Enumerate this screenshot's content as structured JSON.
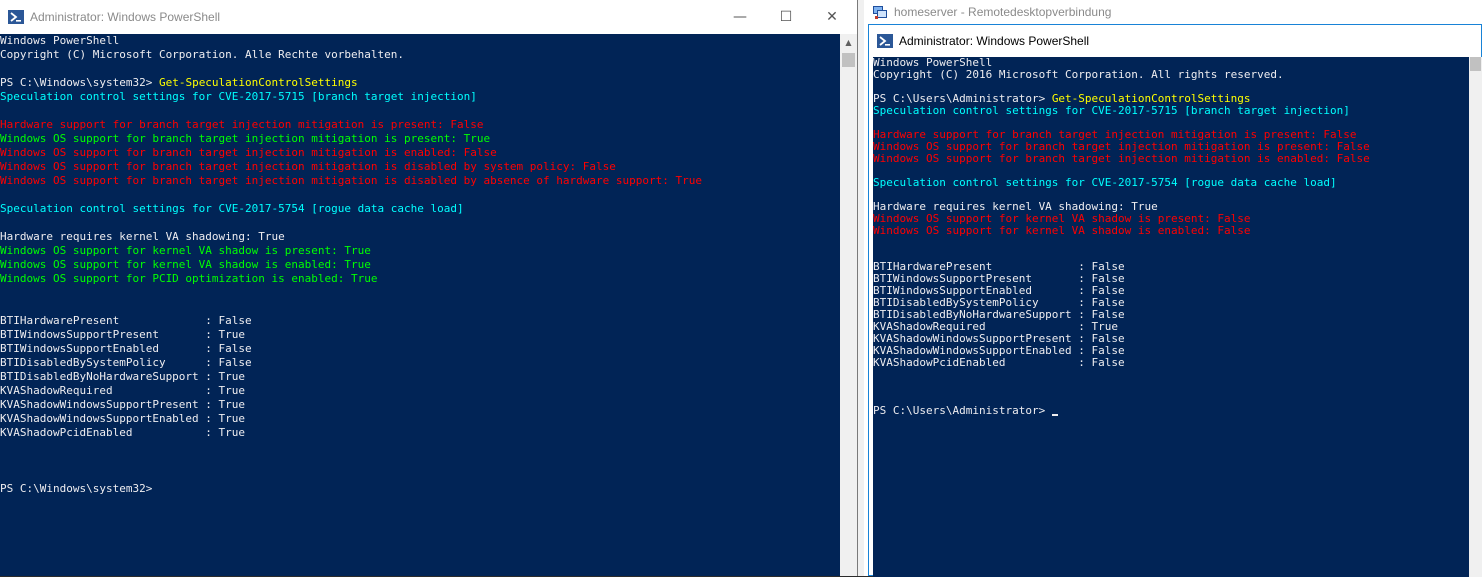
{
  "left_window": {
    "title": "Administrator: Windows PowerShell",
    "controls": {
      "minimize": "—",
      "maximize": "☐",
      "close": "✕"
    },
    "console": {
      "lines": [
        {
          "text": "Windows PowerShell",
          "color": "default"
        },
        {
          "text": "Copyright (C) Microsoft Corporation. Alle Rechte vorbehalten.",
          "color": "default"
        },
        {
          "text": "",
          "color": "default"
        },
        {
          "prompt": "PS C:\\Windows\\system32> ",
          "cmd": "Get-SpeculationControlSettings"
        },
        {
          "text": "Speculation control settings for CVE-2017-5715 [branch target injection]",
          "color": "cyan"
        },
        {
          "text": "",
          "color": "default"
        },
        {
          "text": "Hardware support for branch target injection mitigation is present: False",
          "color": "red"
        },
        {
          "text": "Windows OS support for branch target injection mitigation is present: True",
          "color": "green"
        },
        {
          "text": "Windows OS support for branch target injection mitigation is enabled: False",
          "color": "red"
        },
        {
          "text": "Windows OS support for branch target injection mitigation is disabled by system policy: False",
          "color": "red"
        },
        {
          "text": "Windows OS support for branch target injection mitigation is disabled by absence of hardware support: True",
          "color": "red"
        },
        {
          "text": "",
          "color": "default"
        },
        {
          "text": "Speculation control settings for CVE-2017-5754 [rogue data cache load]",
          "color": "cyan"
        },
        {
          "text": "",
          "color": "default"
        },
        {
          "text": "Hardware requires kernel VA shadowing: True",
          "color": "default"
        },
        {
          "text": "Windows OS support for kernel VA shadow is present: True",
          "color": "green"
        },
        {
          "text": "Windows OS support for kernel VA shadow is enabled: True",
          "color": "green"
        },
        {
          "text": "Windows OS support for PCID optimization is enabled: True",
          "color": "green"
        },
        {
          "text": "",
          "color": "default"
        },
        {
          "text": "",
          "color": "default"
        },
        {
          "text": "BTIHardwarePresent             : False",
          "color": "default"
        },
        {
          "text": "BTIWindowsSupportPresent       : True",
          "color": "default"
        },
        {
          "text": "BTIWindowsSupportEnabled       : False",
          "color": "default"
        },
        {
          "text": "BTIDisabledBySystemPolicy      : False",
          "color": "default"
        },
        {
          "text": "BTIDisabledByNoHardwareSupport : True",
          "color": "default"
        },
        {
          "text": "KVAShadowRequired              : True",
          "color": "default"
        },
        {
          "text": "KVAShadowWindowsSupportPresent : True",
          "color": "default"
        },
        {
          "text": "KVAShadowWindowsSupportEnabled : True",
          "color": "default"
        },
        {
          "text": "KVAShadowPcidEnabled           : True",
          "color": "default"
        },
        {
          "text": "",
          "color": "default"
        },
        {
          "text": "",
          "color": "default"
        },
        {
          "text": "",
          "color": "default"
        },
        {
          "text": "PS C:\\Windows\\system32>",
          "color": "default"
        }
      ]
    }
  },
  "right_window": {
    "rdp_title": "homeserver - Remotedesktopverbindung",
    "inner_title": "Administrator: Windows PowerShell",
    "console": {
      "lines": [
        {
          "text": "Windows PowerShell",
          "color": "default"
        },
        {
          "text": "Copyright (C) 2016 Microsoft Corporation. All rights reserved.",
          "color": "default"
        },
        {
          "text": "",
          "color": "default"
        },
        {
          "prompt": "PS C:\\Users\\Administrator> ",
          "cmd": "Get-SpeculationControlSettings"
        },
        {
          "text": "Speculation control settings for CVE-2017-5715 [branch target injection]",
          "color": "cyan"
        },
        {
          "text": "",
          "color": "default"
        },
        {
          "text": "Hardware support for branch target injection mitigation is present: False",
          "color": "red"
        },
        {
          "text": "Windows OS support for branch target injection mitigation is present: False",
          "color": "red"
        },
        {
          "text": "Windows OS support for branch target injection mitigation is enabled: False",
          "color": "red"
        },
        {
          "text": "",
          "color": "default"
        },
        {
          "text": "Speculation control settings for CVE-2017-5754 [rogue data cache load]",
          "color": "cyan"
        },
        {
          "text": "",
          "color": "default"
        },
        {
          "text": "Hardware requires kernel VA shadowing: True",
          "color": "default"
        },
        {
          "text": "Windows OS support for kernel VA shadow is present: False",
          "color": "red"
        },
        {
          "text": "Windows OS support for kernel VA shadow is enabled: False",
          "color": "red"
        },
        {
          "text": "",
          "color": "default"
        },
        {
          "text": "",
          "color": "default"
        },
        {
          "text": "BTIHardwarePresent             : False",
          "color": "default"
        },
        {
          "text": "BTIWindowsSupportPresent       : False",
          "color": "default"
        },
        {
          "text": "BTIWindowsSupportEnabled       : False",
          "color": "default"
        },
        {
          "text": "BTIDisabledBySystemPolicy      : False",
          "color": "default"
        },
        {
          "text": "BTIDisabledByNoHardwareSupport : False",
          "color": "default"
        },
        {
          "text": "KVAShadowRequired              : True",
          "color": "default"
        },
        {
          "text": "KVAShadowWindowsSupportPresent : False",
          "color": "default"
        },
        {
          "text": "KVAShadowWindowsSupportEnabled : False",
          "color": "default"
        },
        {
          "text": "KVAShadowPcidEnabled           : False",
          "color": "default"
        },
        {
          "text": "",
          "color": "default"
        },
        {
          "text": "",
          "color": "default"
        },
        {
          "text": "",
          "color": "default"
        },
        {
          "text": "PS C:\\Users\\Administrator> ",
          "color": "default",
          "cursor": true
        }
      ]
    }
  },
  "colors": {
    "console_bg": "#012456",
    "default": "#eeedf0",
    "yellow": "#ffff00",
    "cyan": "#00ffff",
    "red": "#ff0000",
    "green": "#00ff00"
  }
}
